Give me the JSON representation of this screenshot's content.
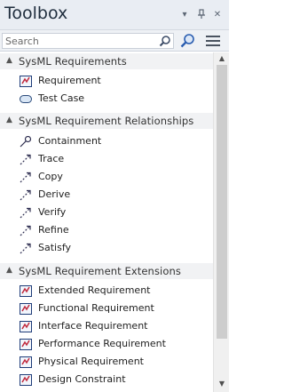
{
  "window": {
    "title": "Toolbox",
    "dropdown_glyph": "▾",
    "pin_glyph": "ᵖ",
    "close_glyph": "✕"
  },
  "search": {
    "placeholder": "Search",
    "value": ""
  },
  "groups": [
    {
      "label": "SysML Requirements",
      "items": [
        {
          "label": "Requirement",
          "icon": "requirement-icon"
        },
        {
          "label": "Test Case",
          "icon": "test-case-icon"
        }
      ]
    },
    {
      "label": "SysML Requirement Relationships",
      "items": [
        {
          "label": "Containment",
          "icon": "containment-icon"
        },
        {
          "label": "Trace",
          "icon": "dashed-arrow-icon"
        },
        {
          "label": "Copy",
          "icon": "dashed-arrow-icon"
        },
        {
          "label": "Derive",
          "icon": "dashed-arrow-icon"
        },
        {
          "label": "Verify",
          "icon": "dashed-arrow-icon"
        },
        {
          "label": "Refine",
          "icon": "dashed-arrow-icon"
        },
        {
          "label": "Satisfy",
          "icon": "dashed-arrow-icon"
        }
      ]
    },
    {
      "label": "SysML Requirement Extensions",
      "items": [
        {
          "label": "Extended Requirement",
          "icon": "requirement-icon"
        },
        {
          "label": "Functional Requirement",
          "icon": "requirement-icon"
        },
        {
          "label": "Interface Requirement",
          "icon": "requirement-icon"
        },
        {
          "label": "Performance Requirement",
          "icon": "requirement-icon"
        },
        {
          "label": "Physical Requirement",
          "icon": "requirement-icon"
        },
        {
          "label": "Design Constraint",
          "icon": "requirement-icon"
        }
      ]
    }
  ],
  "colors": {
    "titlebar_bg": "#e9edf3",
    "header_bg": "#f1f2f4",
    "requirement_icon_border": "#1e3c78",
    "requirement_icon_mark": "#c0283c",
    "relationship_arrow": "#2b2b4e"
  }
}
